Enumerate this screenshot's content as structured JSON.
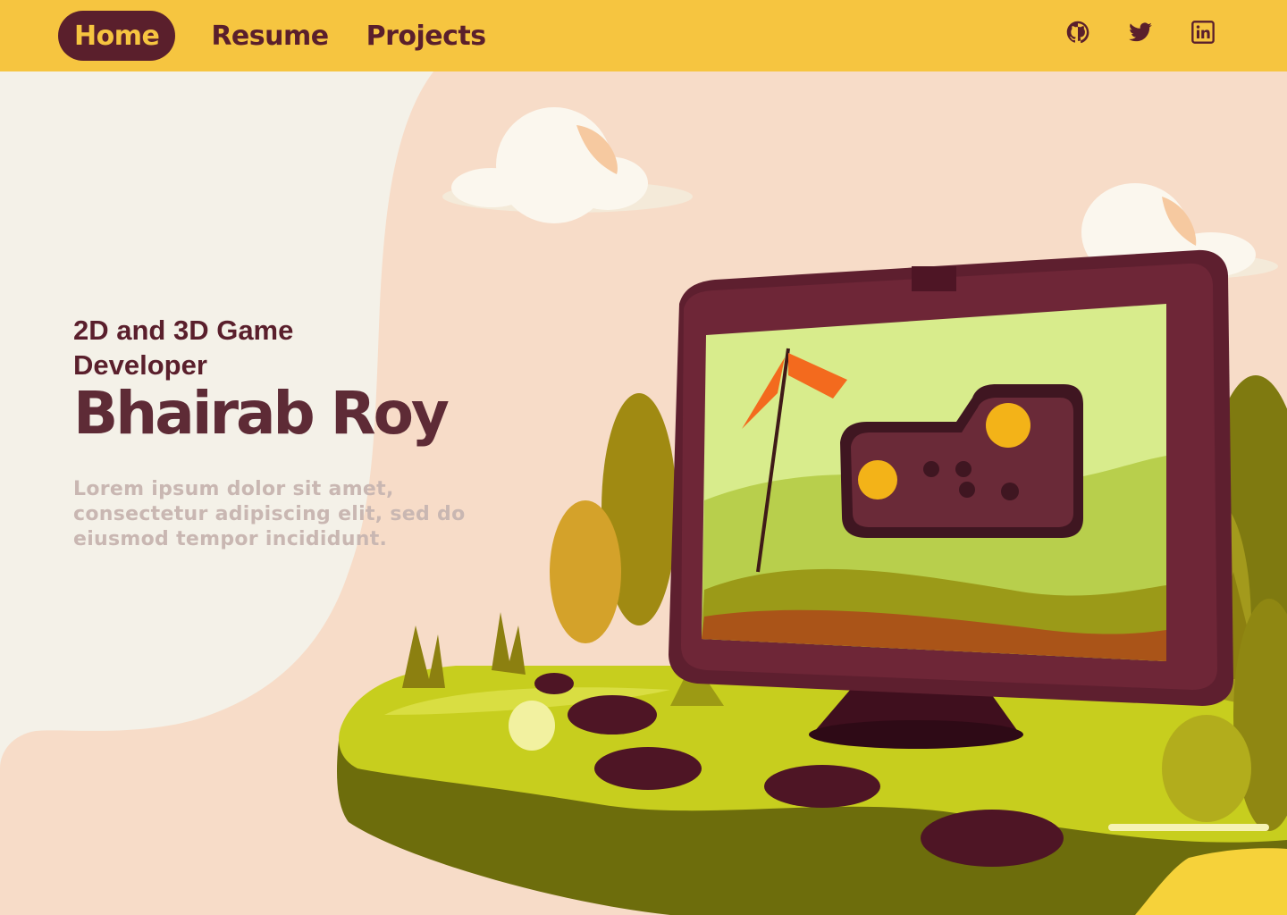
{
  "nav": {
    "links": [
      {
        "label": "Home",
        "active": true
      },
      {
        "label": "Resume",
        "active": false
      },
      {
        "label": "Projects",
        "active": false
      }
    ],
    "socials": [
      "github-icon",
      "twitter-icon",
      "linkedin-icon"
    ]
  },
  "hero": {
    "role": "2D and 3D Game Developer",
    "name": "Bhairab Roy",
    "description": "Lorem ipsum dolor sit amet, consectetur adipiscing elit, sed do eiusmod tempor incididunt."
  },
  "colors": {
    "nav_bg": "#f6c540",
    "brand_dark": "#5a1f2c",
    "hero_light": "#f4f1e8",
    "hero_peach": "#f7dcc8"
  }
}
